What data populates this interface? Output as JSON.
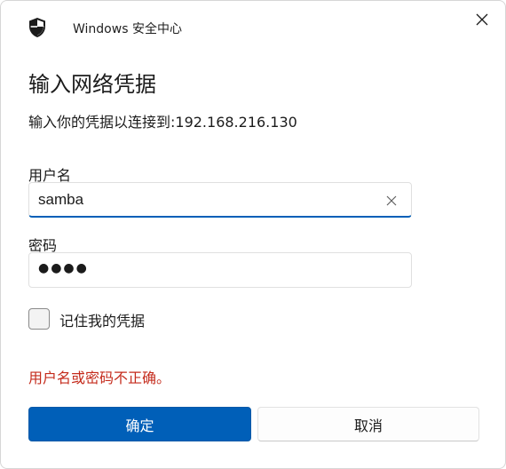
{
  "window": {
    "app_title": "Windows 安全中心"
  },
  "dialog": {
    "heading": "输入网络凭据",
    "subtext": "输入你的凭据以连接到:192.168.216.130",
    "username": {
      "label": "用户名",
      "value": "samba"
    },
    "password": {
      "label": "密码",
      "masked_value": "●●●●"
    },
    "remember": {
      "label": "记住我的凭据",
      "checked": false
    },
    "error": "用户名或密码不正确。",
    "ok_label": "确定",
    "cancel_label": "取消"
  },
  "icons": {
    "app": "shield-icon",
    "close": "close-icon",
    "clear": "clear-icon"
  },
  "colors": {
    "accent": "#005fb8",
    "error": "#c42b1c"
  }
}
